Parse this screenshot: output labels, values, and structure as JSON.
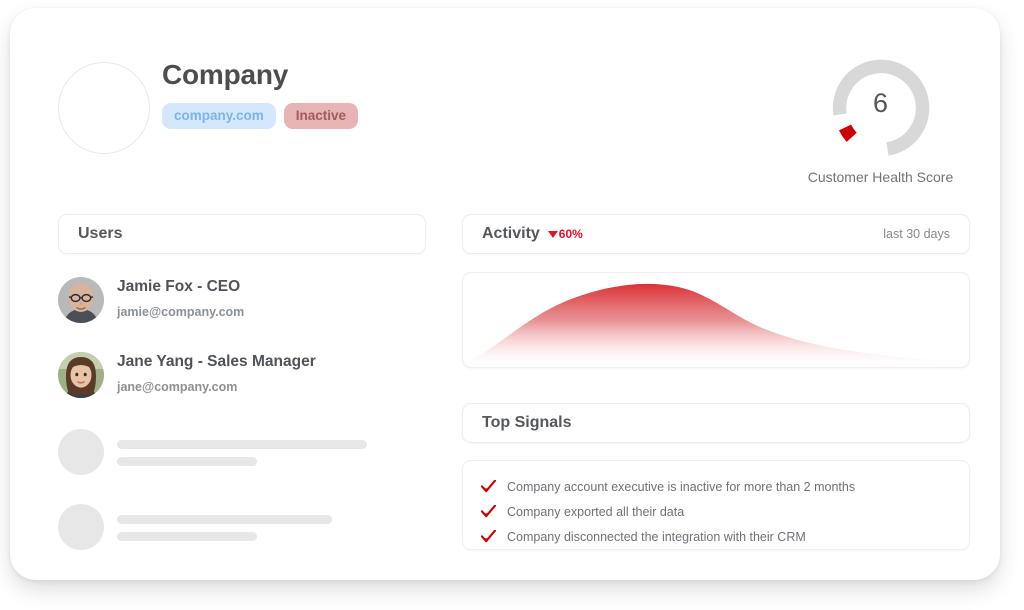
{
  "header": {
    "company_name": "Company",
    "domain_badge": "company.com",
    "status_badge": "Inactive",
    "logo_alt": "company-logo"
  },
  "health": {
    "score": "6",
    "label": "Customer Health Score",
    "track_color": "#d8d8d8",
    "segment_color": "#cc0000",
    "max": 10
  },
  "users_panel": {
    "title": "Users",
    "users": [
      {
        "name": "Jamie Fox - CEO",
        "email": "jamie@company.com",
        "avatar": "avatar-man-glasses"
      },
      {
        "name": "Jane Yang - Sales Manager",
        "email": "jane@company.com",
        "avatar": "avatar-woman-brown-hair"
      }
    ],
    "skeleton_rows": [
      {
        "bar1_width": 250,
        "bar2_width": 140
      },
      {
        "bar1_width": 215,
        "bar2_width": 140
      }
    ]
  },
  "activity_panel": {
    "title": "Activity",
    "delta_value": "60%",
    "delta_direction": "down",
    "delta_color": "#e1112a",
    "range_label": "last 30 days"
  },
  "signals_panel": {
    "title": "Top Signals",
    "check_color": "#cc0000",
    "items": [
      "Company account executive is inactive for more than 2 months",
      "Company exported all their data",
      "Company disconnected the integration with their CRM"
    ]
  },
  "chart_data": {
    "type": "area",
    "title": "Activity",
    "xlabel": "",
    "ylabel": "",
    "grid": false,
    "legend": null,
    "annotations": [
      "60% decrease",
      "last 30 days"
    ],
    "fill_top_color": "#d9262b",
    "fill_bottom_color": "#ffffff",
    "x": [
      0,
      5,
      10,
      15,
      20,
      25,
      30,
      35,
      40,
      45,
      50,
      55,
      60,
      65,
      70,
      75,
      80,
      85,
      90,
      95,
      100
    ],
    "y": [
      2,
      18,
      38,
      58,
      76,
      88,
      94,
      95,
      92,
      85,
      74,
      62,
      50,
      40,
      32,
      25,
      20,
      15,
      12,
      9,
      7
    ],
    "ylim": [
      0,
      100
    ],
    "xlim": [
      0,
      100
    ],
    "peak_x": 35,
    "peak_y": 95
  }
}
